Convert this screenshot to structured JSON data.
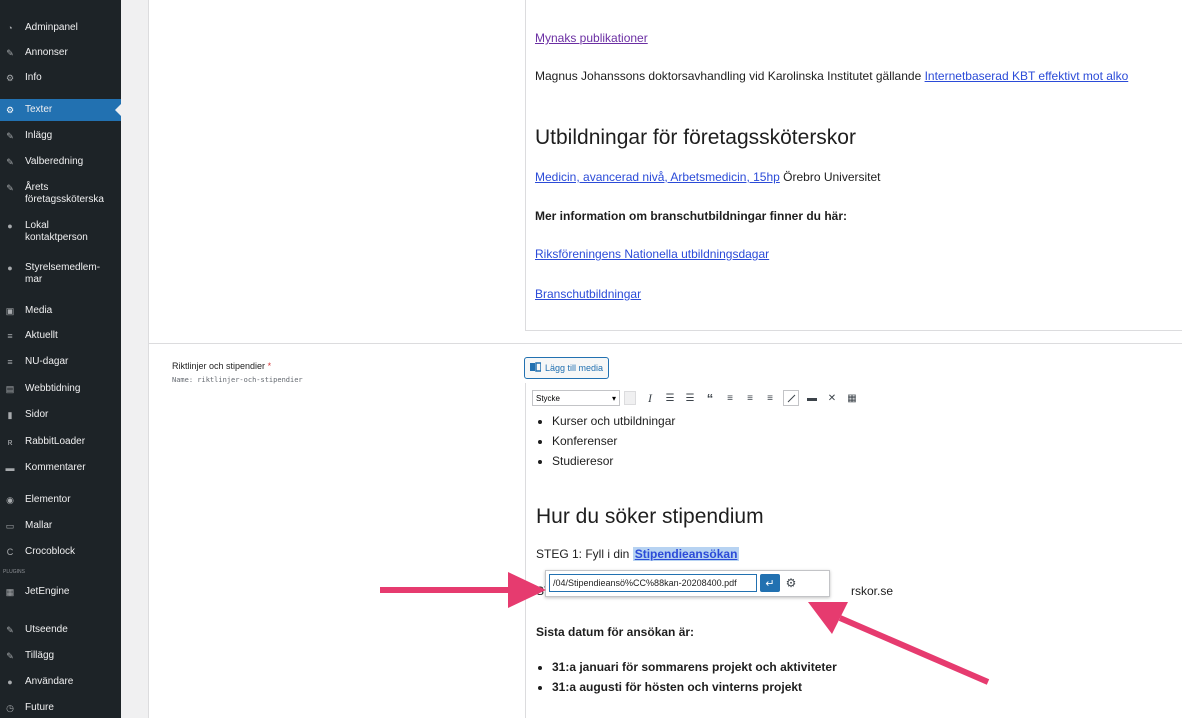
{
  "sidebar": {
    "items": [
      {
        "label": "Adminpanel",
        "icon": "dashboard-icon"
      },
      {
        "label": "Annonser",
        "icon": "pin-icon"
      },
      {
        "label": "Info",
        "icon": "gear-icon"
      },
      {
        "label": "Texter",
        "icon": "gear-icon",
        "active": true
      },
      {
        "label": "Inlägg",
        "icon": "pin-icon"
      },
      {
        "label": "Valberedning",
        "icon": "pin-icon"
      },
      {
        "label": "Årets\nföretagssköterska",
        "icon": "pin-icon"
      },
      {
        "label": "Lokal\nkontaktperson",
        "icon": "user-icon"
      },
      {
        "label": "Styrelsemedlem-\nmar",
        "icon": "user-icon"
      },
      {
        "label": "Media",
        "icon": "media-icon"
      },
      {
        "label": "Aktuellt",
        "icon": "list-icon"
      },
      {
        "label": "NU-dagar",
        "icon": "list-icon"
      },
      {
        "label": "Webbtidning",
        "icon": "table-icon"
      },
      {
        "label": "Sidor",
        "icon": "page-icon"
      },
      {
        "label": "RabbitLoader",
        "icon": "rabbit-icon"
      },
      {
        "label": "Kommentarer",
        "icon": "comment-icon"
      },
      {
        "label": "Elementor",
        "icon": "elementor-icon"
      },
      {
        "label": "Mallar",
        "icon": "folder-icon"
      },
      {
        "label": "Crocoblock",
        "icon": "crocoblock-icon"
      },
      {
        "label": "JetEngine",
        "icon": "jetengine-icon"
      },
      {
        "label": "Utseende",
        "icon": "brush-icon"
      },
      {
        "label": "Tillägg",
        "icon": "plugin-icon"
      },
      {
        "label": "Användare",
        "icon": "user-icon"
      },
      {
        "label": "Future",
        "icon": "clock-icon"
      }
    ],
    "small_label": "PLUGINS"
  },
  "upper": {
    "link1": "Mynaks publikationer",
    "para_text": "Magnus Johanssons doktorsavhandling vid Karolinska Institutet gällande ",
    "para_link": "Internetbaserad KBT effektivt mot alko",
    "heading": "Utbildningar för företagssköterskor",
    "course_link": "Medicin, avancerad nivå, Arbetsmedicin, 15hp",
    "course_text": " Örebro Universitet",
    "more_info": "Mer information om branschutbildningar finner du här:",
    "link2": "Riksföreningens Nationella utbildningsdagar",
    "link3": "Branschutbildningar"
  },
  "field": {
    "label": "Riktlinjer och stipendier",
    "required_mark": "*",
    "name_line": "Name: riktlinjer-och-stipendier",
    "add_media": "Lägg till media"
  },
  "editor": {
    "format_value": "Stycke",
    "bullets1": [
      "Kurser och utbildningar",
      "Konferenser",
      "Studieresor"
    ],
    "heading": "Hur du söker stipendium",
    "step1_text": "STEG 1: Fyll i din ",
    "step1_link": "Stipendieansökan",
    "step2_start": "ST",
    "step2_end": "rskor.se",
    "deadline": "Sista datum för ansökan är:",
    "bullets2": [
      "31:a januari för sommarens projekt och aktiviteter",
      "31:a augusti för hösten och vinterns projekt"
    ],
    "link_url": "/04/Stipendieansö%CC%88kan-20208400.pdf"
  },
  "colors": {
    "sidebar_bg": "#1d2327",
    "active": "#2271b1",
    "arrow": "#e63b6f"
  }
}
